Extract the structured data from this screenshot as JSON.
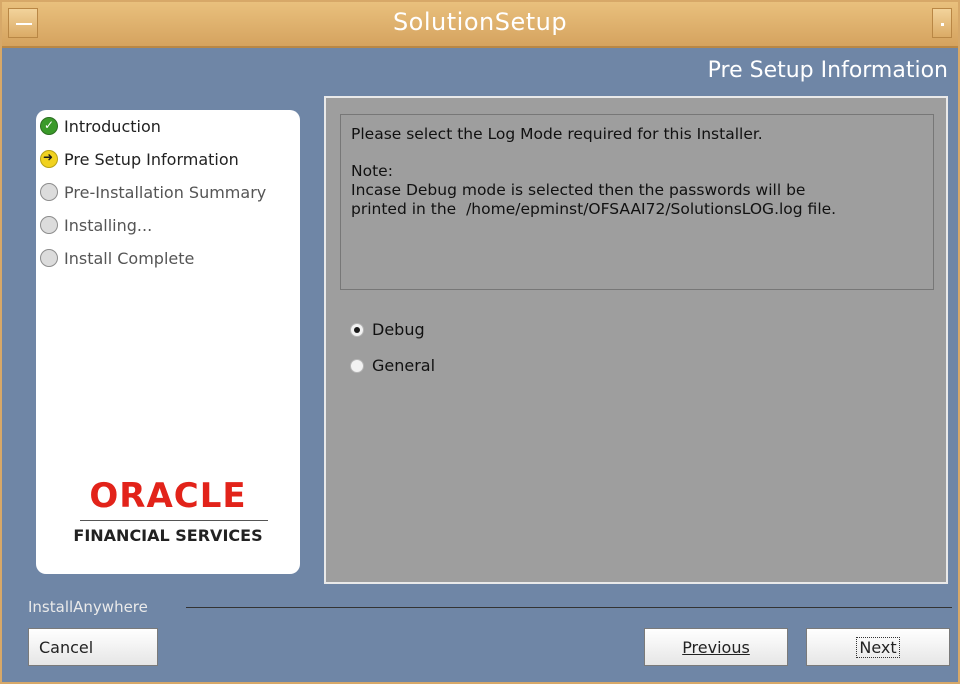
{
  "window": {
    "title": "SolutionSetup"
  },
  "header": {
    "title": "Pre Setup Information"
  },
  "steps": [
    {
      "label": "Introduction",
      "state": "done"
    },
    {
      "label": "Pre Setup Information",
      "state": "current"
    },
    {
      "label": "Pre-Installation Summary",
      "state": "pending"
    },
    {
      "label": "Installing...",
      "state": "pending"
    },
    {
      "label": "Install Complete",
      "state": "pending"
    }
  ],
  "logo": {
    "brand": "ORACLE",
    "subtitle": "FINANCIAL SERVICES"
  },
  "message": {
    "line1": "Please select the Log Mode required for this Installer.",
    "note_label": "Note:",
    "line2": "Incase Debug mode is selected then the passwords will be",
    "line3": "printed in the  /home/epminst/OFSAAI72/SolutionsLOG.log file."
  },
  "log_mode": {
    "options": [
      {
        "label": "Debug",
        "selected": true
      },
      {
        "label": "General",
        "selected": false
      }
    ]
  },
  "footer": {
    "brand": "InstallAnywhere",
    "cancel_label": "Cancel",
    "previous_label": "Previous",
    "next_label": "Next"
  },
  "colors": {
    "titlebar": "#d9a862",
    "background": "#6f86a6",
    "content_panel": "#9e9e9e",
    "oracle_red": "#e2231a"
  }
}
